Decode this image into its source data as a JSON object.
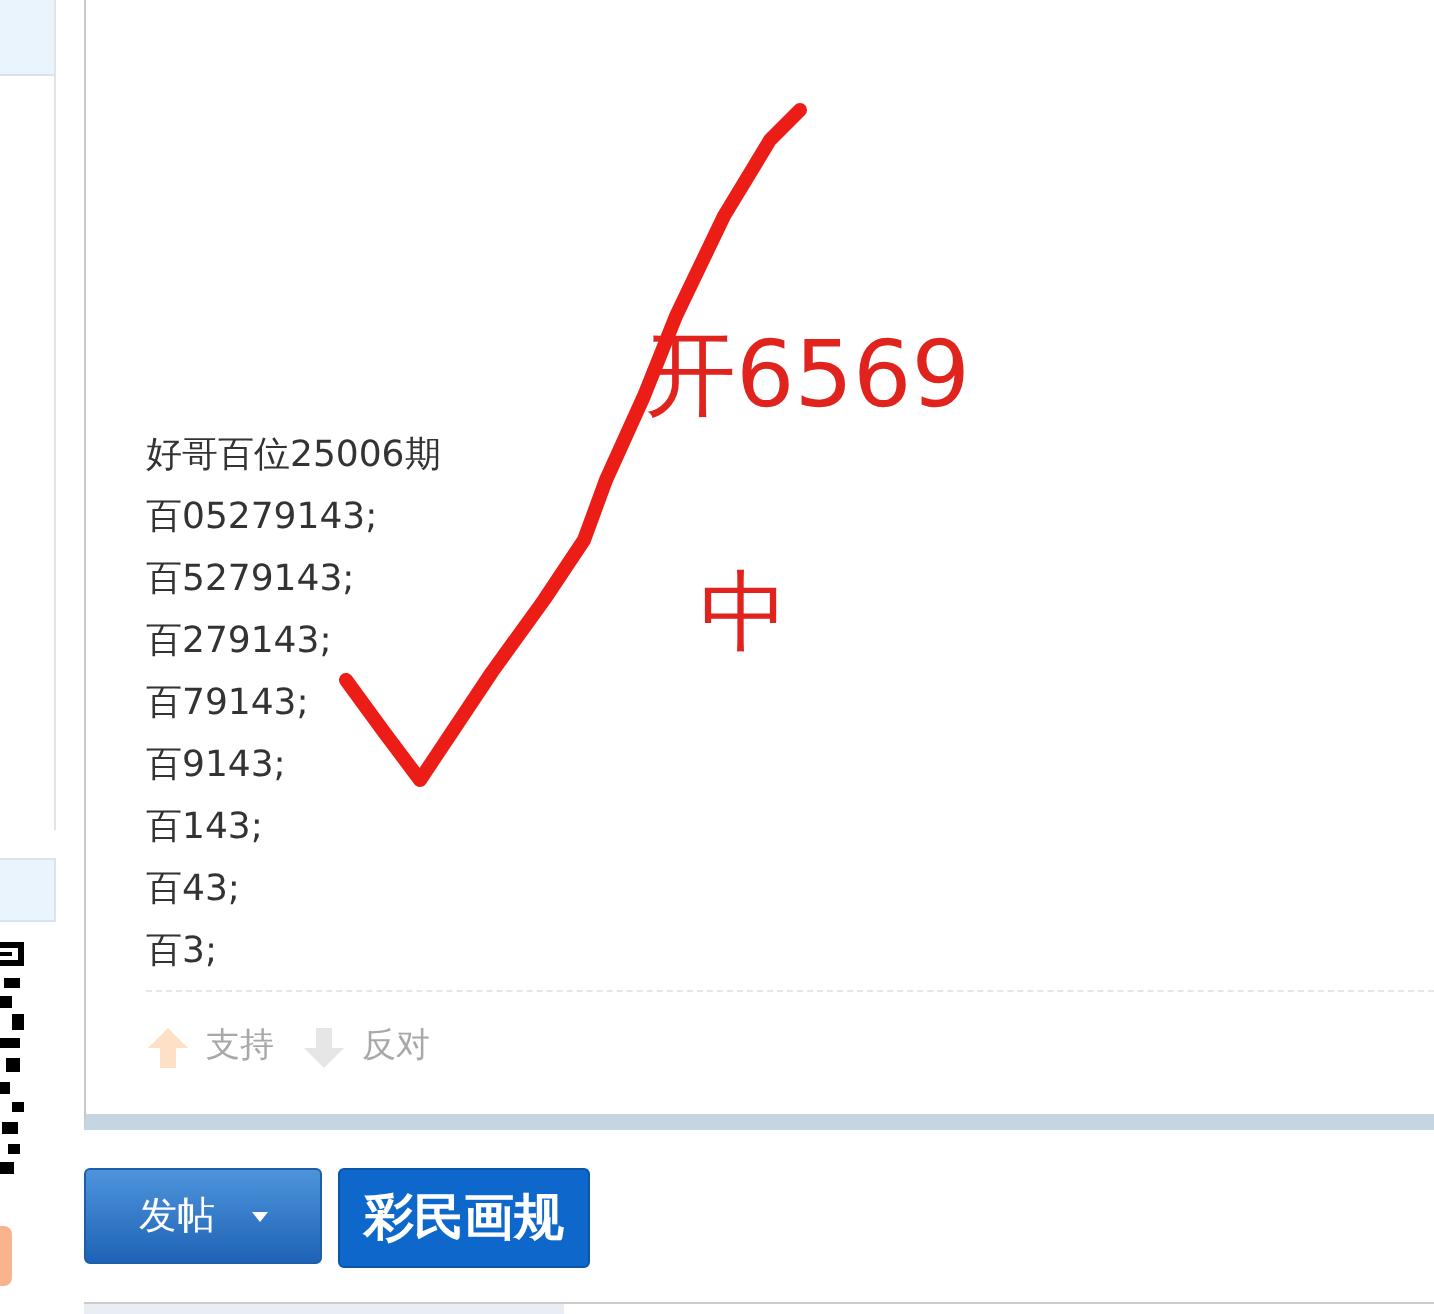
{
  "post": {
    "lines": [
      "好哥百位25006期",
      "百05279143;",
      "百5279143;",
      "百279143;",
      "百79143;",
      "百9143;",
      "百143;",
      "百43;",
      "百3;"
    ],
    "annotations": [
      {
        "text": "开6569",
        "kind": "result"
      },
      {
        "text": "中",
        "kind": "hit"
      }
    ],
    "votes": [
      {
        "label": "支持",
        "kind": "up"
      },
      {
        "label": "反对",
        "kind": "down"
      }
    ]
  },
  "buttons": [
    {
      "label": "发帖",
      "kind": "dropdown"
    },
    {
      "label": "彩民画规",
      "kind": "plain"
    }
  ]
}
